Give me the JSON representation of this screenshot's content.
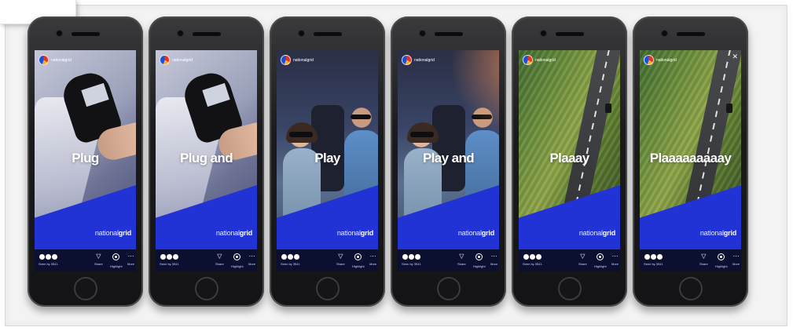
{
  "stories": [
    {
      "headline": "Plug",
      "scene": "charger",
      "has_close": false
    },
    {
      "headline": "Plug and",
      "scene": "charger",
      "has_close": false
    },
    {
      "headline": "Play",
      "scene": "car",
      "has_close": false
    },
    {
      "headline": "Play and",
      "scene": "car-warm",
      "has_close": false
    },
    {
      "headline": "Plaaay",
      "scene": "road",
      "has_close": false
    },
    {
      "headline": "Plaaaaaaaaay",
      "scene": "road",
      "has_close": true
    }
  ],
  "story_header": {
    "username": "nationalgrid"
  },
  "brand": {
    "prefix": "national",
    "bold": "grid",
    "color": "#2233d6"
  },
  "bottom_bar": {
    "seen_label": "Seen by 3541",
    "share_label": "Share",
    "highlight_label": "Highlight",
    "more_label": "More",
    "more_icon": "⋯",
    "share_icon": "send-icon",
    "highlight_icon": "highlight-icon"
  }
}
